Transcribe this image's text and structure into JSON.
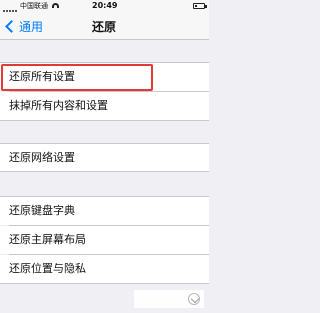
{
  "status_bar": {
    "carrier": "中国联通",
    "time": "20:49",
    "battery_text": "",
    "battery_level": 0.2
  },
  "nav": {
    "back_label": "通用",
    "title": "还原"
  },
  "settings": [
    {
      "label": "还原所有设置"
    },
    {
      "label": "抹掉所有内容和设置"
    },
    {
      "label": "还原网络设置"
    },
    {
      "label": "还原键盘字典"
    },
    {
      "label": "还原主屏幕布局"
    },
    {
      "label": "还原位置与隐私"
    }
  ],
  "watermark": {
    "text": ""
  }
}
